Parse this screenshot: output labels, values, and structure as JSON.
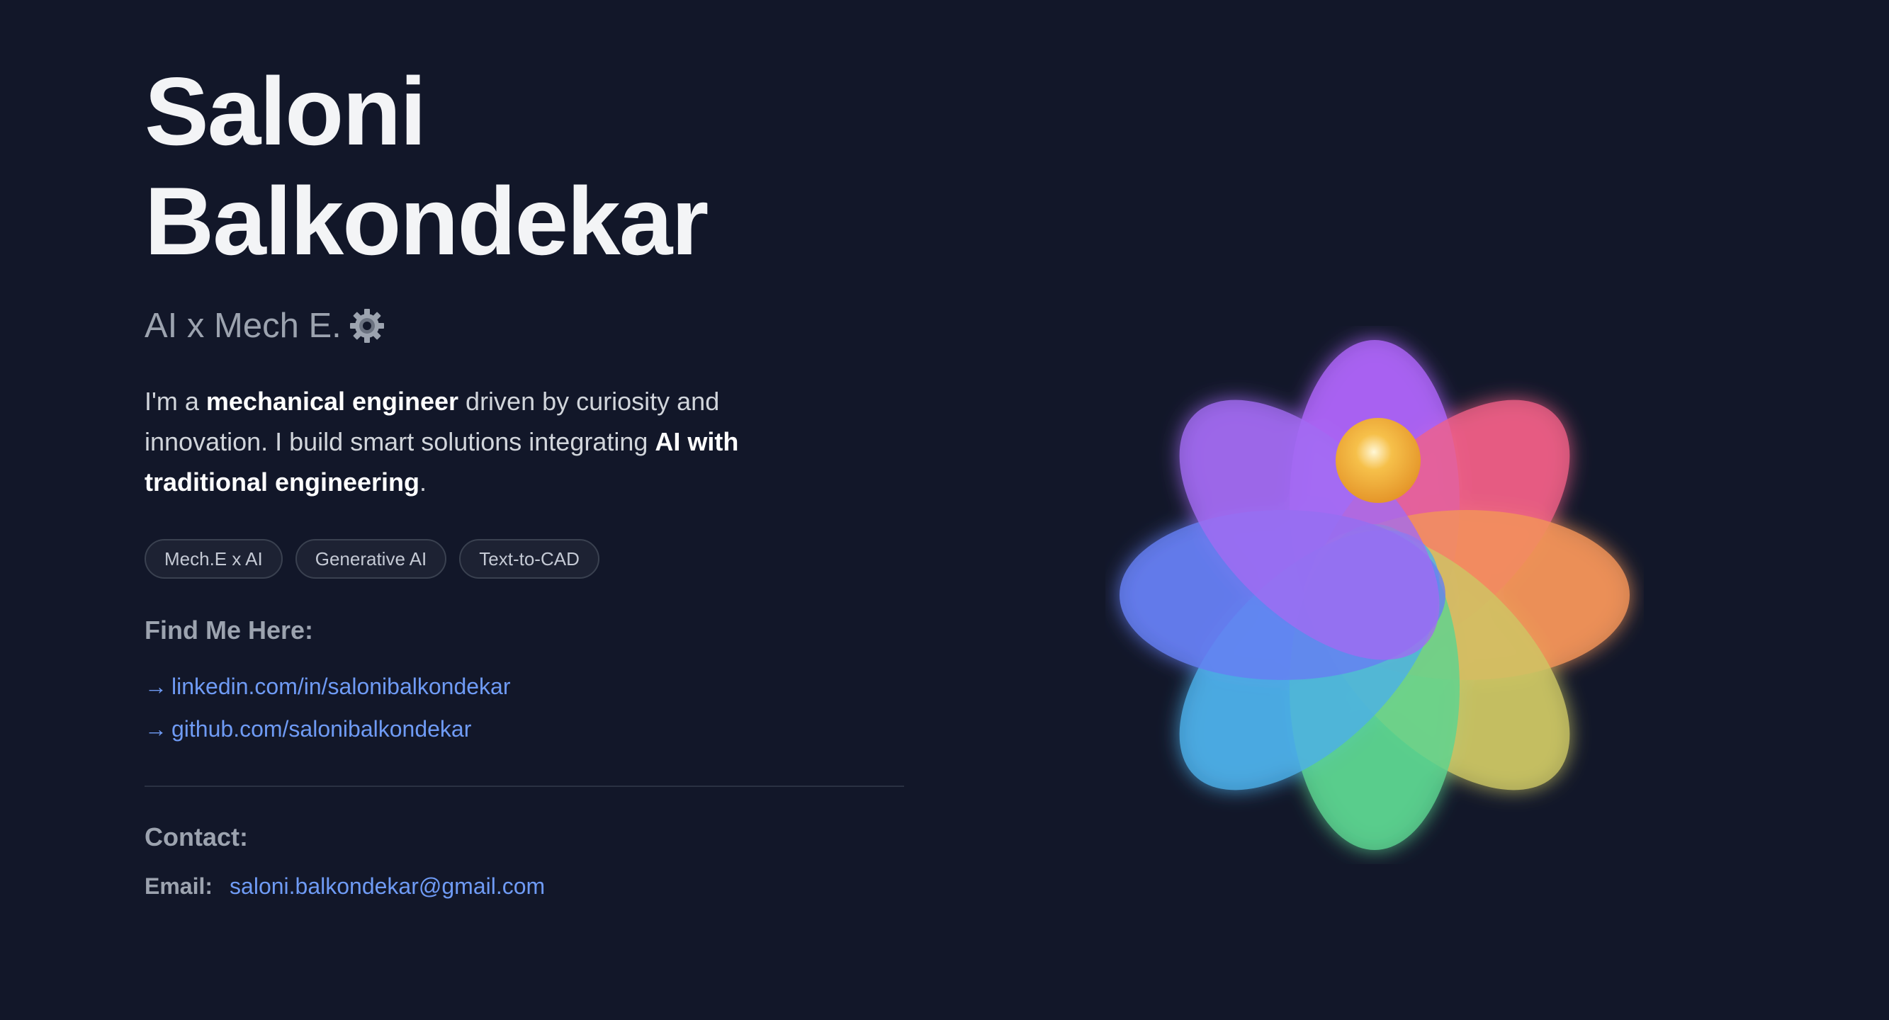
{
  "profile": {
    "name_line1": "Saloni",
    "name_line2": "Balkondekar",
    "subtitle": "AI x Mech E.",
    "subtitle_icon": "gear-icon"
  },
  "bio": {
    "p1": "I'm a ",
    "b1": "mechanical engineer",
    "p2": " driven by curiosity and innovation. I build smart solutions integrating ",
    "b2": "AI with traditional engineering",
    "p3": "."
  },
  "tags": [
    "Mech.E x AI",
    "Generative AI",
    "Text-to-CAD"
  ],
  "find": {
    "title": "Find Me Here:",
    "arrow": "→",
    "links": [
      "linkedin.com/in/salonibalkondekar",
      "github.com/salonibalkondekar"
    ]
  },
  "contact": {
    "title": "Contact:",
    "email_label": "Email:",
    "email": "saloni.balkondekar@gmail.com"
  },
  "colors": {
    "background": "#121729",
    "link": "#6f9bf5",
    "muted": "#9ca3af"
  }
}
